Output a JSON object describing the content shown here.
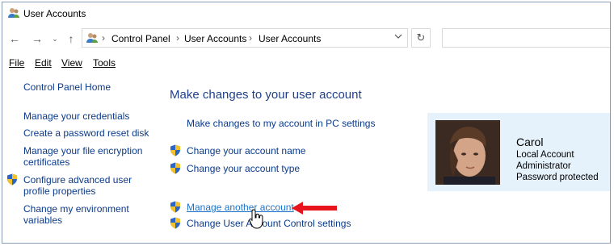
{
  "window": {
    "title": "User Accounts"
  },
  "nav": {
    "breadcrumbs": [
      "Control Panel",
      "User Accounts",
      "User Accounts"
    ],
    "search_placeholder": ""
  },
  "menu": {
    "items": [
      "File",
      "Edit",
      "View",
      "Tools"
    ]
  },
  "left": {
    "home": "Control Panel Home",
    "credentials": "Manage your credentials",
    "reset_disk": "Create a password reset disk",
    "encryption_l1": "Manage your file encryption",
    "encryption_l2": "certificates",
    "advanced_l1": "Configure advanced user",
    "advanced_l2": "profile properties",
    "env_l1": "Change my environment",
    "env_l2": "variables"
  },
  "main": {
    "heading": "Make changes to your user account",
    "pc_settings": "Make changes to my account in PC settings",
    "change_name": "Change your account name",
    "change_type": "Change your account type",
    "manage_another": "Manage another account",
    "uac": "Change User Account Control settings"
  },
  "user": {
    "name": "Carol",
    "type": "Local Account",
    "role": "Administrator",
    "protection": "Password protected"
  },
  "colors": {
    "link": "#0a3a8c",
    "heading": "#1f3f8a",
    "card_bg": "#e5f1fb",
    "arrow": "#e8141b"
  }
}
